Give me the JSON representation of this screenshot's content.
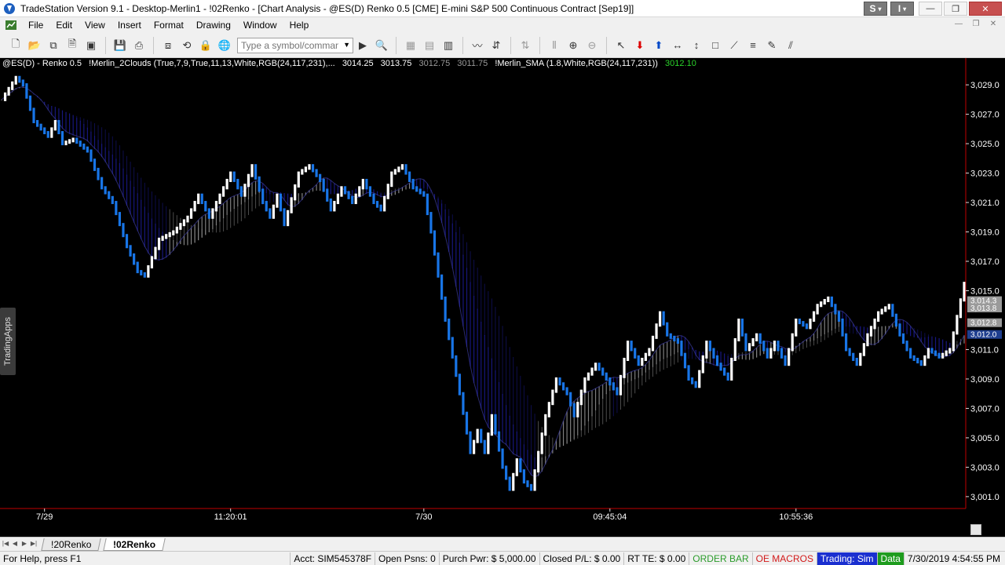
{
  "window": {
    "title": "TradeStation Version 9.1 - Desktop-Merlin1 - !02Renko - [Chart Analysis - @ES(D) Renko 0.5 [CME] E-mini S&P 500 Continuous Contract [Sep19]]",
    "combo_s": "S",
    "combo_i": "I"
  },
  "menu": {
    "items": [
      "File",
      "Edit",
      "View",
      "Insert",
      "Format",
      "Drawing",
      "Window",
      "Help"
    ]
  },
  "toolbar": {
    "symbol_placeholder": "Type a symbol/command"
  },
  "chart": {
    "symbol_label": "@ES(D) - Renko 0.5",
    "study1": "!Merlin_2Clouds (True,7,9,True,11,13,White,RGB(24,117,231),...",
    "study1_v1": "3014.25",
    "study1_v2": "3013.75",
    "study1_v3": "3012.75",
    "study1_v4": "3011.75",
    "study2": "!Merlin_SMA (1.8,White,RGB(24,117,231))",
    "study2_v1": "3012.10",
    "side_tab": "TradingApps",
    "colors": {
      "up": "#ffffff",
      "down": "#1875e7",
      "cloud_blue": "#1a1a8a",
      "cloud_gray": "#8c8c8c",
      "axis_line": "#c00000"
    }
  },
  "chart_data": {
    "type": "line",
    "title": "",
    "xlabel": "",
    "ylabel": "",
    "ylim": [
      3000.3,
      3030.5
    ],
    "y_ticks": [
      "3,029.0",
      "3,027.0",
      "3,025.0",
      "3,023.0",
      "3,021.0",
      "3,019.0",
      "3,017.0",
      "3,015.0",
      "3,011.0",
      "3,009.0",
      "3,007.0",
      "3,005.0",
      "3,003.0",
      "3,001.0"
    ],
    "y_tick_values": [
      3029,
      3027,
      3025,
      3023,
      3021,
      3019,
      3017,
      3015,
      3011,
      3009,
      3007,
      3005,
      3003,
      3001
    ],
    "price_flags": [
      {
        "label": "3,014.3",
        "value": 3014.3,
        "color": "#9a9a9a"
      },
      {
        "label": "3,013.8",
        "value": 3013.8,
        "color": "#9a9a9a"
      },
      {
        "label": "3,012.8",
        "value": 3012.8,
        "color": "#9a9a9a"
      },
      {
        "label": "3,012.0",
        "value": 3012.0,
        "color": "#1f3f8f"
      }
    ],
    "x_labels": [
      "7/29",
      "11:20:01",
      "7/30",
      "09:45:04",
      "10:55:36"
    ],
    "x_label_bricks": [
      12,
      64,
      118,
      170,
      222
    ],
    "brick_count": 270,
    "price_path": [
      [
        0,
        3028.0
      ],
      [
        4,
        3029.5
      ],
      [
        6,
        3029.0
      ],
      [
        9,
        3026.5
      ],
      [
        13,
        3025.5
      ],
      [
        15,
        3026.5
      ],
      [
        17,
        3025.0
      ],
      [
        20,
        3025.3
      ],
      [
        24,
        3024.5
      ],
      [
        28,
        3022.0
      ],
      [
        31,
        3021.0
      ],
      [
        35,
        3018.0
      ],
      [
        38,
        3016.3
      ],
      [
        40,
        3016.0
      ],
      [
        44,
        3018.5
      ],
      [
        48,
        3019.0
      ],
      [
        52,
        3020.0
      ],
      [
        55,
        3021.5
      ],
      [
        58,
        3020.0
      ],
      [
        61,
        3021.5
      ],
      [
        64,
        3023.0
      ],
      [
        67,
        3021.5
      ],
      [
        70,
        3023.5
      ],
      [
        73,
        3021.0
      ],
      [
        75,
        3020.0
      ],
      [
        77,
        3021.5
      ],
      [
        79,
        3019.5
      ],
      [
        83,
        3023.0
      ],
      [
        86,
        3023.5
      ],
      [
        89,
        3022.5
      ],
      [
        92,
        3020.5
      ],
      [
        95,
        3022.0
      ],
      [
        98,
        3021.0
      ],
      [
        101,
        3022.5
      ],
      [
        104,
        3021.0
      ],
      [
        106,
        3020.5
      ],
      [
        109,
        3023.0
      ],
      [
        112,
        3023.5
      ],
      [
        115,
        3022.0
      ],
      [
        118,
        3021.5
      ],
      [
        120,
        3019.0
      ],
      [
        124,
        3013.0
      ],
      [
        128,
        3008.0
      ],
      [
        131,
        3004.0
      ],
      [
        133,
        3005.5
      ],
      [
        135,
        3004.0
      ],
      [
        137,
        3006.5
      ],
      [
        140,
        3003.0
      ],
      [
        142,
        3001.5
      ],
      [
        144,
        3003.5
      ],
      [
        146,
        3002.0
      ],
      [
        148,
        3001.5
      ],
      [
        152,
        3006.5
      ],
      [
        155,
        3009.0
      ],
      [
        158,
        3008.0
      ],
      [
        160,
        3006.5
      ],
      [
        163,
        3009.0
      ],
      [
        166,
        3010.0
      ],
      [
        169,
        3009.0
      ],
      [
        172,
        3008.0
      ],
      [
        175,
        3011.5
      ],
      [
        178,
        3010.0
      ],
      [
        181,
        3011.0
      ],
      [
        184,
        3013.5
      ],
      [
        186,
        3012.0
      ],
      [
        189,
        3011.5
      ],
      [
        192,
        3009.0
      ],
      [
        194,
        3008.5
      ],
      [
        197,
        3011.5
      ],
      [
        200,
        3010.0
      ],
      [
        203,
        3009.0
      ],
      [
        206,
        3013.0
      ],
      [
        208,
        3011.0
      ],
      [
        211,
        3012.0
      ],
      [
        214,
        3010.5
      ],
      [
        216,
        3011.5
      ],
      [
        219,
        3010.0
      ],
      [
        222,
        3013.0
      ],
      [
        225,
        3012.5
      ],
      [
        228,
        3014.0
      ],
      [
        231,
        3014.5
      ],
      [
        234,
        3013.0
      ],
      [
        236,
        3011.0
      ],
      [
        239,
        3010.0
      ],
      [
        242,
        3012.0
      ],
      [
        245,
        3013.5
      ],
      [
        248,
        3014.0
      ],
      [
        251,
        3012.0
      ],
      [
        254,
        3010.5
      ],
      [
        257,
        3010.0
      ],
      [
        259,
        3011.0
      ],
      [
        262,
        3010.5
      ],
      [
        265,
        3011.0
      ],
      [
        269,
        3015.5
      ]
    ]
  },
  "tabs": {
    "items": [
      "!20Renko",
      "!02Renko"
    ],
    "active": 1
  },
  "status": {
    "help": "For Help, press F1",
    "acct": "Acct: SIM545378F",
    "open_psns": "Open Psns: 0",
    "purch_pwr": "Purch Pwr: $ 5,000.00",
    "closed_pl": "Closed P/L: $ 0.00",
    "rt_te": "RT TE: $ 0.00",
    "order_bar": "ORDER BAR",
    "oe_macros": "OE MACROS",
    "trading": "Trading: Sim",
    "data": "Data",
    "datetime": "7/30/2019 4:54:55 PM"
  }
}
